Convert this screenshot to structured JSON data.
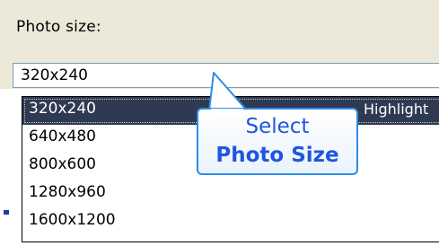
{
  "photo_size": {
    "label": "Photo size:",
    "selected_value": "320x240",
    "options": [
      {
        "label": "320x240",
        "selected": true,
        "trailing": "Highlight"
      },
      {
        "label": "640x480",
        "selected": false
      },
      {
        "label": "800x600",
        "selected": false
      },
      {
        "label": "1280x960",
        "selected": false
      },
      {
        "label": "1600x1200",
        "selected": false
      }
    ]
  },
  "callout": {
    "line1": "Select",
    "line2": "Photo Size"
  },
  "colors": {
    "panel_background": "#ece9d8",
    "selected_row": "#2f3a52",
    "callout_border": "#2d8de6",
    "callout_text": "#1f55e0"
  }
}
